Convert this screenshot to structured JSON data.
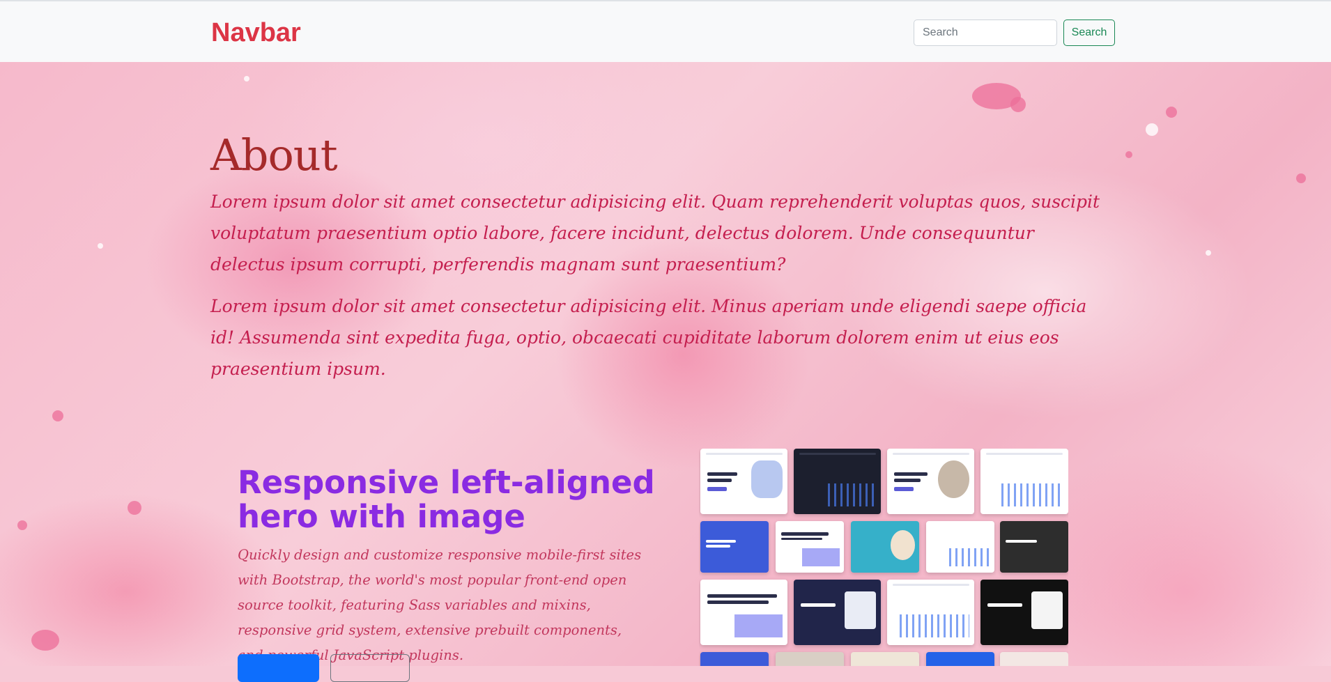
{
  "navbar": {
    "brand": "Navbar",
    "search_placeholder": "Search",
    "search_button": "Search"
  },
  "about": {
    "title": "About",
    "paragraphs": [
      "Lorem ipsum dolor sit amet consectetur adipisicing elit. Quam reprehenderit voluptas quos, suscipit voluptatum praesentium optio labore, facere incidunt, delectus dolorem. Unde consequuntur delectus ipsum corrupti, perferendis magnam sunt praesentium?",
      "Lorem ipsum dolor sit amet consectetur adipisicing elit. Minus aperiam unde eligendi saepe officia id! Assumenda sint expedita fuga, optio, obcaecati cupiditate laborum dolorem enim ut eius eos praesentium ipsum."
    ]
  },
  "hero": {
    "title": "Responsive left-aligned hero with image",
    "lead": "Quickly design and customize responsive mobile-first sites with Bootstrap, the world's most popular front-end open source toolkit, featuring Sass variables and mixins, responsive grid system, extensive prebuilt components, and powerful JavaScript plugins.",
    "image_alt": "Bootstrap Themes"
  },
  "colors": {
    "brand": "#dc3545",
    "search_button": "#198754",
    "about_title": "#a52a2a",
    "about_text": "#c41e4e",
    "hero_title": "#8a2be2",
    "primary_button": "#0d6efd"
  }
}
